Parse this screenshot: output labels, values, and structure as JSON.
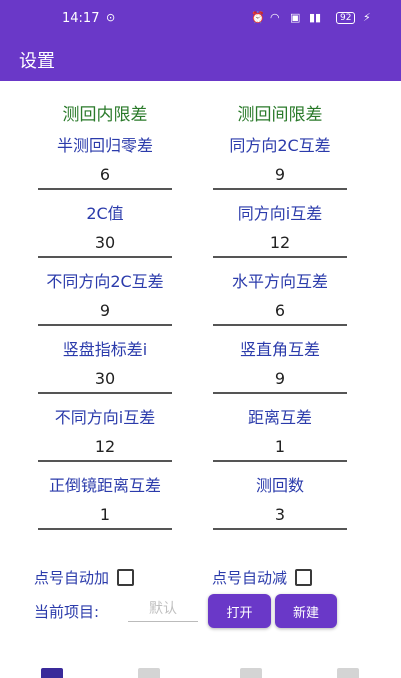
{
  "status_bar": {
    "time": "14:17",
    "battery": "92"
  },
  "app_bar": {
    "title": "设置"
  },
  "left_column": {
    "header": "测回内限差",
    "fields": [
      {
        "label": "半测回归零差",
        "value": "6"
      },
      {
        "label": "2C值",
        "value": "30"
      },
      {
        "label": "不同方向2C互差",
        "value": "9"
      },
      {
        "label": "竖盘指标差i",
        "value": "30"
      },
      {
        "label": "不同方向i互差",
        "value": "12"
      },
      {
        "label": "正倒镜距离互差",
        "value": "1"
      }
    ]
  },
  "right_column": {
    "header": "测回间限差",
    "fields": [
      {
        "label": "同方向2C互差",
        "value": "9"
      },
      {
        "label": "同方向i互差",
        "value": "12"
      },
      {
        "label": "水平方向互差",
        "value": "6"
      },
      {
        "label": "竖直角互差",
        "value": "9"
      },
      {
        "label": "距离互差",
        "value": "1"
      },
      {
        "label": "测回数",
        "value": "3"
      }
    ]
  },
  "checkboxes": {
    "auto_increment": {
      "label": "点号自动加",
      "checked": false
    },
    "auto_decrement": {
      "label": "点号自动减",
      "checked": false
    }
  },
  "project": {
    "label": "当前项目:",
    "placeholder": "默认"
  },
  "buttons": {
    "open": "打开",
    "new": "新建"
  },
  "colors": {
    "primary": "#6a38c8",
    "header_text": "#2a7a2a",
    "label_text": "#2b3bab"
  }
}
